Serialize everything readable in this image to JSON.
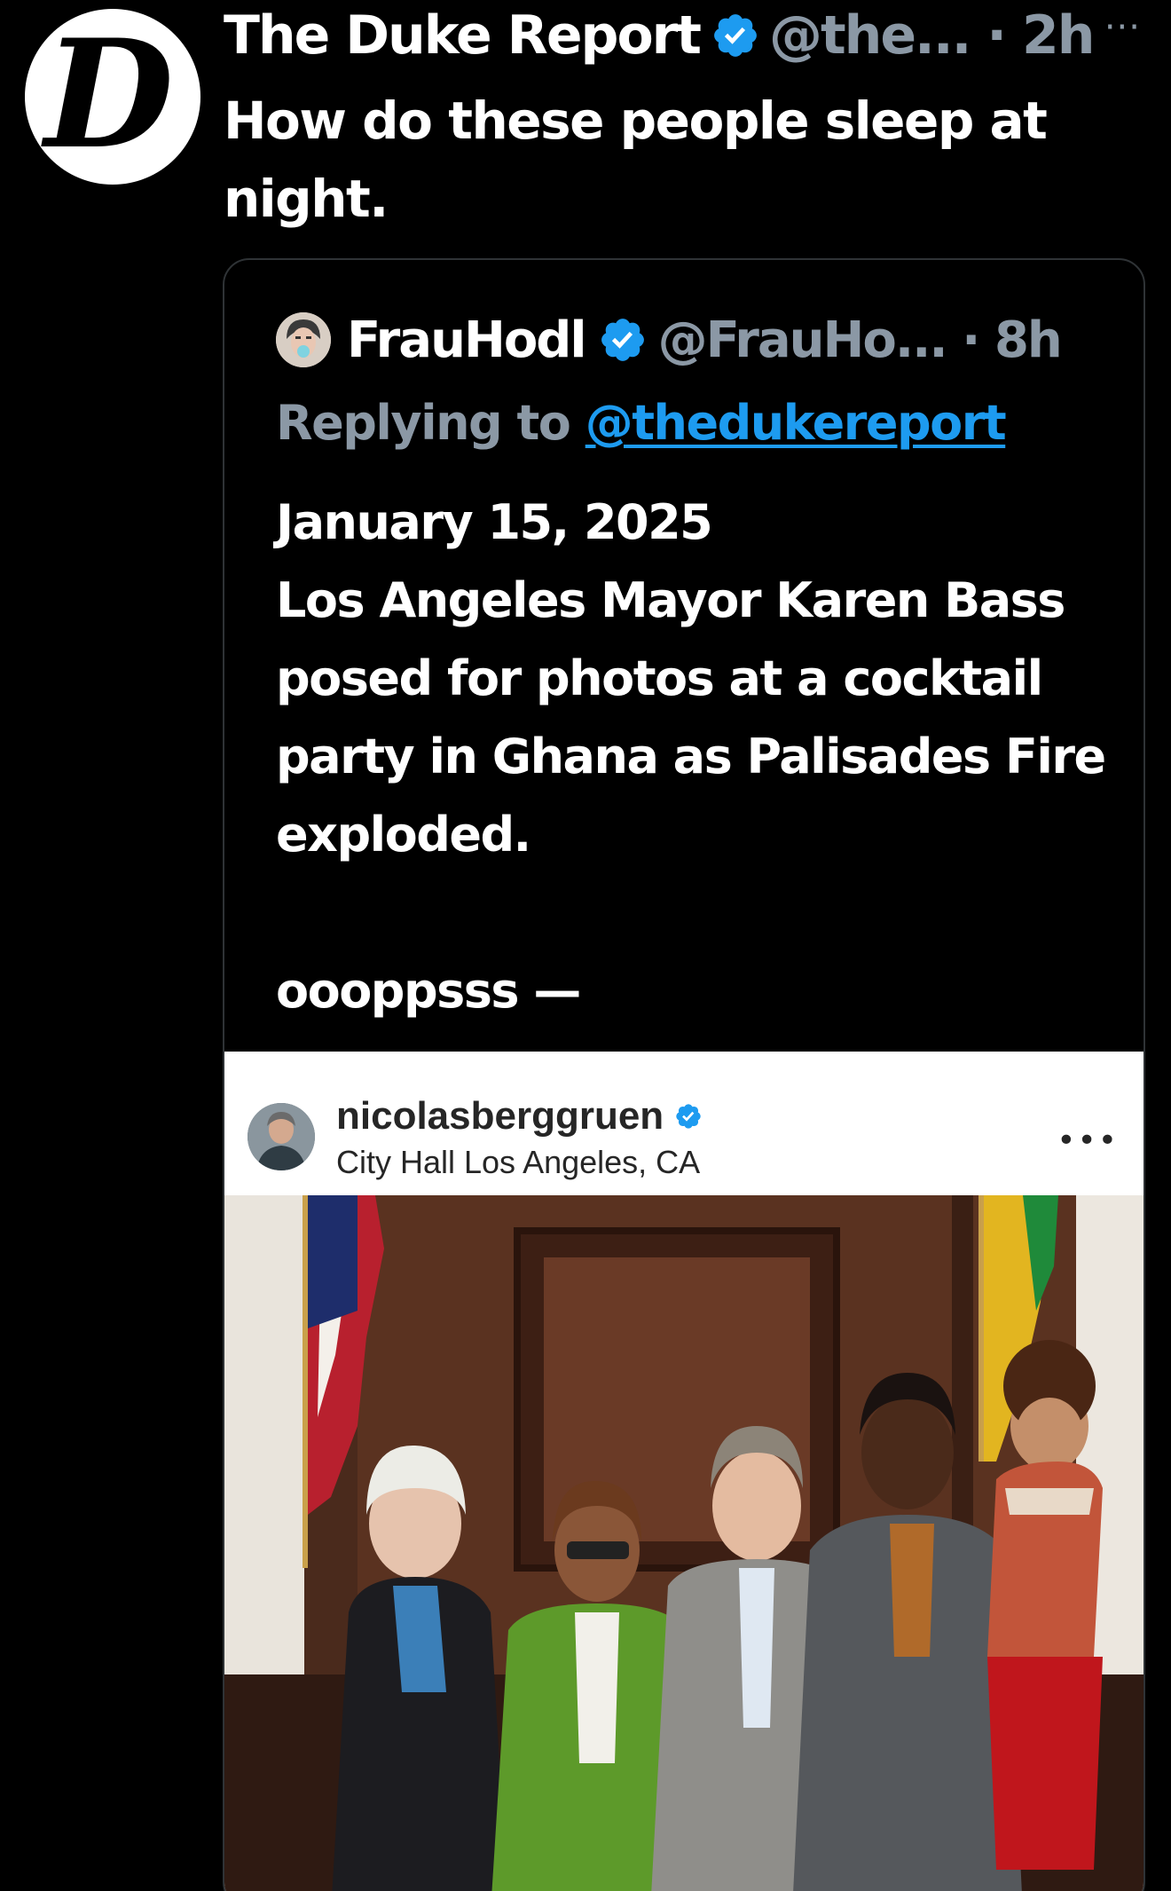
{
  "tweet": {
    "author": {
      "avatar_letter": "D",
      "display_name": "The Duke Report",
      "handle_time": "@the... · 2h",
      "verified": true
    },
    "more_icon": "more-horizontal-icon",
    "text": "How do these people sleep at night."
  },
  "quote": {
    "author": {
      "display_name": "FrauHodl",
      "handle_time": "@FrauHo... · 8h",
      "verified": true
    },
    "reply_prefix": "Replying to",
    "reply_mention": "@thedukereport",
    "text": "January 15, 2025\nLos Angeles Mayor Karen Bass posed for photos at a cocktail party in Ghana as Palisades Fire exploded.\n\noooppsss —",
    "embedded_post": {
      "username": "nicolasberggruen",
      "verified": true,
      "location": "City Hall Los Angeles, CA",
      "more_icon": "more-horizontal-icon"
    }
  },
  "colors": {
    "background": "#000000",
    "text_primary": "#ffffff",
    "text_secondary": "#8b98a5",
    "link": "#1d9bf0",
    "verified": "#1d9bf0",
    "border": "#2f3336"
  }
}
